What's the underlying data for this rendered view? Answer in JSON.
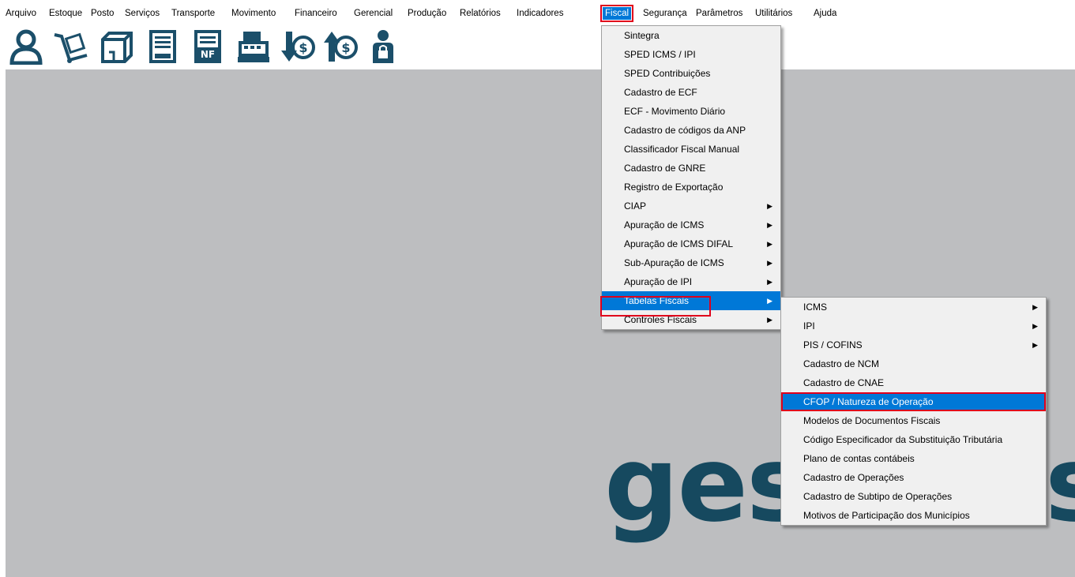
{
  "menubar": {
    "items": [
      "Arquivo",
      "Estoque",
      "Posto",
      "Serviços",
      "Transporte",
      "Movimento",
      "Financeiro",
      "Gerencial",
      "Produção",
      "Relatórios",
      "Indicadores",
      "Fiscal",
      "Segurança",
      "Parâmetros",
      "Utilitários",
      "Ajuda"
    ],
    "active": "Fiscal"
  },
  "toolbar": {
    "icons": [
      "person-icon",
      "hand-truck-icon",
      "box-icon",
      "document-icon",
      "nf-document-icon",
      "cash-register-icon",
      "money-down-icon",
      "money-up-icon",
      "person-lock-icon"
    ]
  },
  "fiscal_menu": {
    "items": [
      {
        "label": "Sintegra",
        "submenu": false
      },
      {
        "label": "SPED ICMS / IPI",
        "submenu": false
      },
      {
        "label": "SPED Contribuições",
        "submenu": false
      },
      {
        "label": "Cadastro de ECF",
        "submenu": false
      },
      {
        "label": "ECF - Movimento Diário",
        "submenu": false
      },
      {
        "label": "Cadastro de códigos da ANP",
        "submenu": false
      },
      {
        "label": "Classificador Fiscal Manual",
        "submenu": false
      },
      {
        "label": "Cadastro de GNRE",
        "submenu": false
      },
      {
        "label": "Registro de Exportação",
        "submenu": false
      },
      {
        "label": "CIAP",
        "submenu": true
      },
      {
        "label": "Apuração de ICMS",
        "submenu": true
      },
      {
        "label": "Apuração de ICMS DIFAL",
        "submenu": true
      },
      {
        "label": "Sub-Apuração de ICMS",
        "submenu": true
      },
      {
        "label": "Apuração de IPI",
        "submenu": true
      },
      {
        "label": "Tabelas Fiscais",
        "submenu": true,
        "highlighted": true
      },
      {
        "label": "Controles Fiscais",
        "submenu": true
      }
    ]
  },
  "tabelas_menu": {
    "items": [
      {
        "label": "ICMS",
        "submenu": true
      },
      {
        "label": "IPI",
        "submenu": true
      },
      {
        "label": "PIS / COFINS",
        "submenu": true
      },
      {
        "label": "Cadastro de NCM",
        "submenu": false
      },
      {
        "label": "Cadastro de CNAE",
        "submenu": false
      },
      {
        "label": "CFOP / Natureza de Operação",
        "submenu": false,
        "highlighted": true
      },
      {
        "label": "Modelos de Documentos Fiscais",
        "submenu": false
      },
      {
        "label": "Código Especificador da Substituição Tributária",
        "submenu": false
      },
      {
        "label": "Plano de contas contábeis",
        "submenu": false
      },
      {
        "label": "Cadastro de Operações",
        "submenu": false
      },
      {
        "label": "Cadastro de Subtipo de Operações",
        "submenu": false
      },
      {
        "label": "Motivos de Participação dos Municípios",
        "submenu": false
      }
    ]
  },
  "logo": {
    "text_left": "ges",
    "text_right": "s"
  },
  "colors": {
    "accent": "#0078d7",
    "highlight_box": "#e0001b",
    "workspace": "#bdbec0",
    "logo": "#16495f",
    "icon": "#1b4f6a"
  }
}
